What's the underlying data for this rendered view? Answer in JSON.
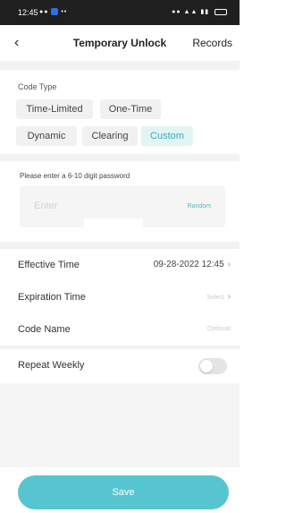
{
  "status_bar": {
    "time": "12:45"
  },
  "nav": {
    "back_icon": "chevron-left-icon",
    "back_glyph": "‹",
    "title": "Temporary Unlock",
    "records_label": "Records"
  },
  "code_type": {
    "label": "Code Type",
    "options": [
      "Time-Limited",
      "One-Time",
      "Dynamic",
      "Clearing",
      "Custom"
    ],
    "selected": "Custom",
    "accent_color": "#37aeb9"
  },
  "password": {
    "label": "Please enter a 6-10 digit password",
    "placeholder": "Enter",
    "random_label": "Random"
  },
  "settings": {
    "effective_time": {
      "label": "Effective Time",
      "value": "09-28-2022 12:45"
    },
    "expiration_time": {
      "label": "Expiration Time",
      "value": "Select"
    },
    "code_name": {
      "label": "Code Name",
      "placeholder": "Optional"
    },
    "repeat_weekly": {
      "label": "Repeat Weekly",
      "enabled": false
    }
  },
  "save_button": {
    "label": "Save",
    "color": "#57c5cf"
  }
}
